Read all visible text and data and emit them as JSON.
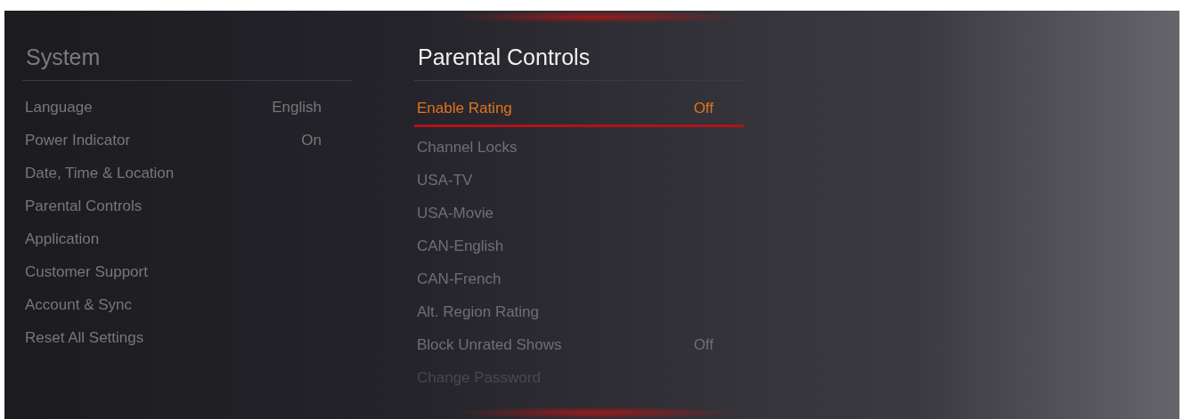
{
  "system_menu": {
    "title": "System",
    "items": [
      {
        "label": "Language",
        "value": "English"
      },
      {
        "label": "Power Indicator",
        "value": "On"
      },
      {
        "label": "Date, Time & Location"
      },
      {
        "label": "Parental Controls"
      },
      {
        "label": "Application"
      },
      {
        "label": "Customer Support"
      },
      {
        "label": "Account & Sync"
      },
      {
        "label": "Reset All Settings"
      }
    ]
  },
  "parental_controls": {
    "title": "Parental Controls",
    "items": [
      {
        "label": "Enable Rating",
        "value": "Off",
        "selected": true
      },
      {
        "label": "Channel Locks",
        "selected": false
      },
      {
        "label": "USA-TV",
        "selected": false
      },
      {
        "label": "USA-Movie",
        "selected": false
      },
      {
        "label": "CAN-English",
        "selected": false
      },
      {
        "label": "CAN-French",
        "selected": false
      },
      {
        "label": "Alt. Region Rating",
        "selected": false
      },
      {
        "label": "Block Unrated Shows",
        "value": "Off",
        "selected": false
      },
      {
        "label": "Change Password",
        "selected": false
      }
    ]
  }
}
